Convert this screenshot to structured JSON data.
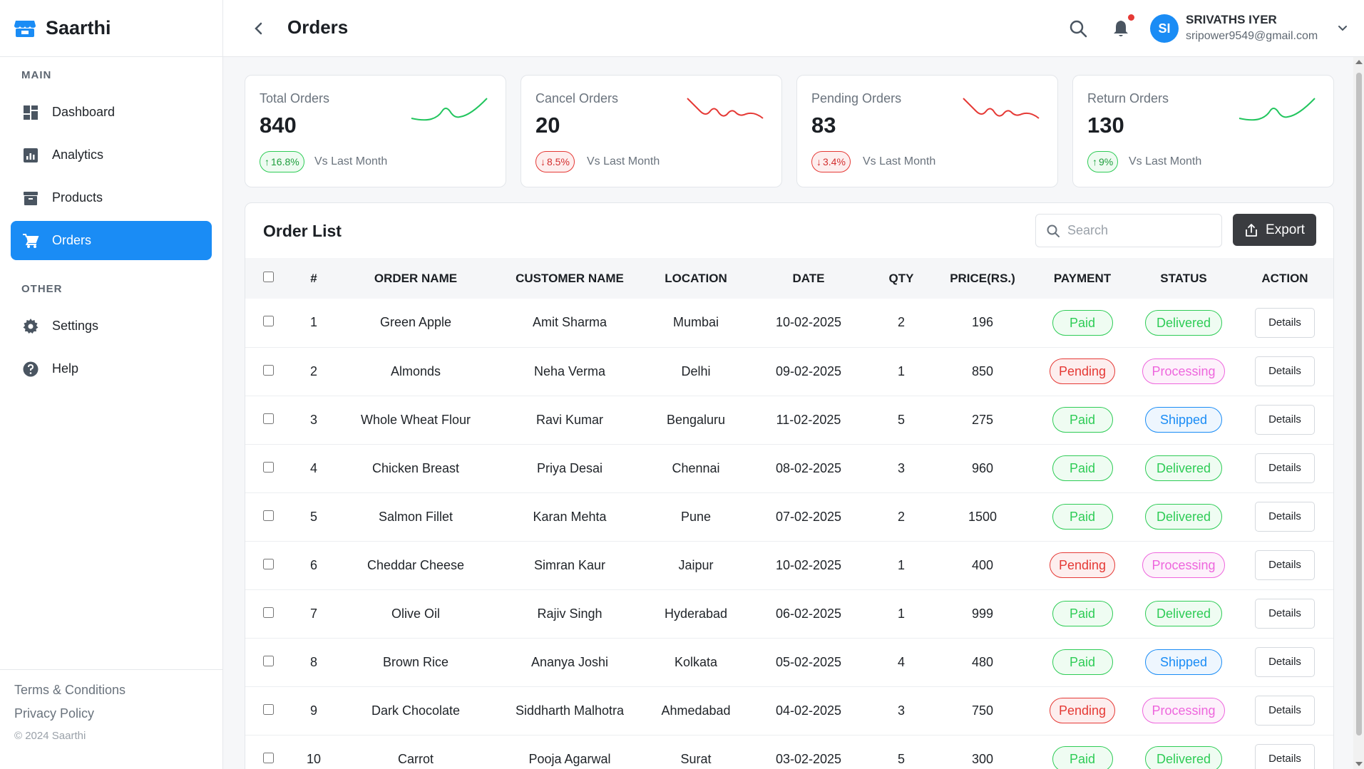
{
  "brand": {
    "name": "Saarthi"
  },
  "sidebar": {
    "main_label": "MAIN",
    "other_label": "OTHER",
    "items": [
      {
        "label": "Dashboard",
        "icon": "dashboard-icon"
      },
      {
        "label": "Analytics",
        "icon": "analytics-icon"
      },
      {
        "label": "Products",
        "icon": "products-icon"
      },
      {
        "label": "Orders",
        "icon": "cart-icon",
        "active": true
      }
    ],
    "other_items": [
      {
        "label": "Settings",
        "icon": "gear-icon"
      },
      {
        "label": "Help",
        "icon": "help-icon"
      }
    ],
    "footer": {
      "terms": "Terms & Conditions",
      "privacy": "Privacy Policy",
      "copyright": "© 2024 Saarthi"
    }
  },
  "header": {
    "title": "Orders",
    "user": {
      "initials": "SI",
      "name": "SRIVATHS IYER",
      "email": "sripower9549@gmail.com"
    }
  },
  "stats": [
    {
      "title": "Total Orders",
      "value": "840",
      "change": "16.8%",
      "direction": "up",
      "vs": "Vs Last Month",
      "color": "#22c55e"
    },
    {
      "title": "Cancel Orders",
      "value": "20",
      "change": "8.5%",
      "direction": "down",
      "vs": "Vs Last Month",
      "color": "#e53935"
    },
    {
      "title": "Pending Orders",
      "value": "83",
      "change": "3.4%",
      "direction": "down",
      "vs": "Vs Last Month",
      "color": "#e53935"
    },
    {
      "title": "Return Orders",
      "value": "130",
      "change": "9%",
      "direction": "up",
      "vs": "Vs Last Month",
      "color": "#22c55e"
    }
  ],
  "orders": {
    "title": "Order List",
    "search_placeholder": "Search",
    "export_label": "Export",
    "columns": [
      "#",
      "ORDER NAME",
      "CUSTOMER NAME",
      "LOCATION",
      "DATE",
      "QTY",
      "PRICE(RS.)",
      "PAYMENT",
      "STATUS",
      "ACTION"
    ],
    "rows": [
      {
        "id": "1",
        "name": "Green Apple",
        "customer": "Amit Sharma",
        "location": "Mumbai",
        "date": "10-02-2025",
        "qty": "2",
        "price": "196",
        "payment": "Paid",
        "status": "Delivered",
        "action": "Details"
      },
      {
        "id": "2",
        "name": "Almonds",
        "customer": "Neha Verma",
        "location": "Delhi",
        "date": "09-02-2025",
        "qty": "1",
        "price": "850",
        "payment": "Pending",
        "status": "Processing",
        "action": "Details"
      },
      {
        "id": "3",
        "name": "Whole Wheat Flour",
        "customer": "Ravi Kumar",
        "location": "Bengaluru",
        "date": "11-02-2025",
        "qty": "5",
        "price": "275",
        "payment": "Paid",
        "status": "Shipped",
        "action": "Details"
      },
      {
        "id": "4",
        "name": "Chicken Breast",
        "customer": "Priya Desai",
        "location": "Chennai",
        "date": "08-02-2025",
        "qty": "3",
        "price": "960",
        "payment": "Paid",
        "status": "Delivered",
        "action": "Details"
      },
      {
        "id": "5",
        "name": "Salmon Fillet",
        "customer": "Karan Mehta",
        "location": "Pune",
        "date": "07-02-2025",
        "qty": "2",
        "price": "1500",
        "payment": "Paid",
        "status": "Delivered",
        "action": "Details"
      },
      {
        "id": "6",
        "name": "Cheddar Cheese",
        "customer": "Simran Kaur",
        "location": "Jaipur",
        "date": "10-02-2025",
        "qty": "1",
        "price": "400",
        "payment": "Pending",
        "status": "Processing",
        "action": "Details"
      },
      {
        "id": "7",
        "name": "Olive Oil",
        "customer": "Rajiv Singh",
        "location": "Hyderabad",
        "date": "06-02-2025",
        "qty": "1",
        "price": "999",
        "payment": "Paid",
        "status": "Delivered",
        "action": "Details"
      },
      {
        "id": "8",
        "name": "Brown Rice",
        "customer": "Ananya Joshi",
        "location": "Kolkata",
        "date": "05-02-2025",
        "qty": "4",
        "price": "480",
        "payment": "Paid",
        "status": "Shipped",
        "action": "Details"
      },
      {
        "id": "9",
        "name": "Dark Chocolate",
        "customer": "Siddharth Malhotra",
        "location": "Ahmedabad",
        "date": "04-02-2025",
        "qty": "3",
        "price": "750",
        "payment": "Pending",
        "status": "Processing",
        "action": "Details"
      },
      {
        "id": "10",
        "name": "Carrot",
        "customer": "Pooja Agarwal",
        "location": "Surat",
        "date": "03-02-2025",
        "qty": "5",
        "price": "300",
        "payment": "Paid",
        "status": "Delivered",
        "action": "Details"
      }
    ]
  },
  "colors": {
    "accent": "#1a8cf5",
    "success": "#2ecc56",
    "danger": "#e53935",
    "processing": "#ee66dd"
  }
}
